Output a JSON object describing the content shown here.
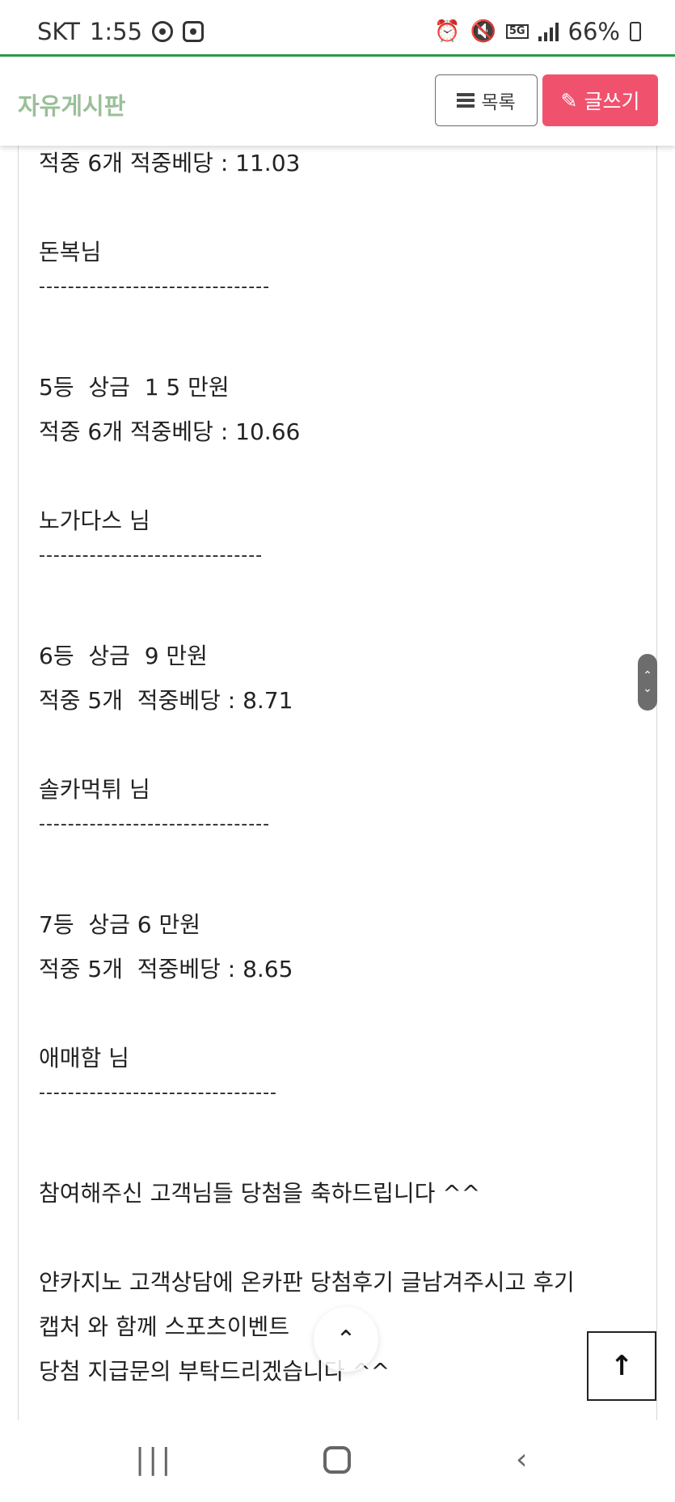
{
  "status_bar": {
    "carrier": "SKT",
    "time": "1:55",
    "network": "5G",
    "battery": "66%"
  },
  "header": {
    "title": "자유게시판",
    "list_button": "목록",
    "write_button": "글쓰기"
  },
  "post": {
    "lines": [
      "적중 6개 적중베당 : 11.03",
      "돈복님",
      "--------------------------------",
      "5등  상금  1 5 만원",
      "적중 6개 적중베당 : 10.66",
      "노가다스 님",
      "-------------------------------",
      "6등  상금  9 만원",
      "적중 5개  적중베당 : 8.71",
      "솔카먹튀 님",
      "--------------------------------",
      "7등  상금 6 만원",
      "적중 5개  적중베당 : 8.65",
      "애매함 님",
      "---------------------------------",
      "참여해주신 고객님들 당첨을 축하드립니다 ^^",
      "얀카지노 고객상담에 온카판 당첨후기 글남겨주시고 후기",
      "캡처 와 함께 스포츠이벤트",
      "당첨 지급문의 부탁드리겠습니다 ^^"
    ]
  },
  "controls": {
    "scroll_up_glyph": "⌃",
    "scroll_down_glyph": "⌄",
    "scroll_top_glyph": "⌃",
    "back_to_top_glyph": "↑"
  },
  "nav": {
    "recent_glyph": "|||",
    "back_glyph": "‹"
  },
  "colors": {
    "accent_green": "#2e9a4b",
    "title_green": "#9bbf9a",
    "write_button_red": "#f0526e"
  }
}
